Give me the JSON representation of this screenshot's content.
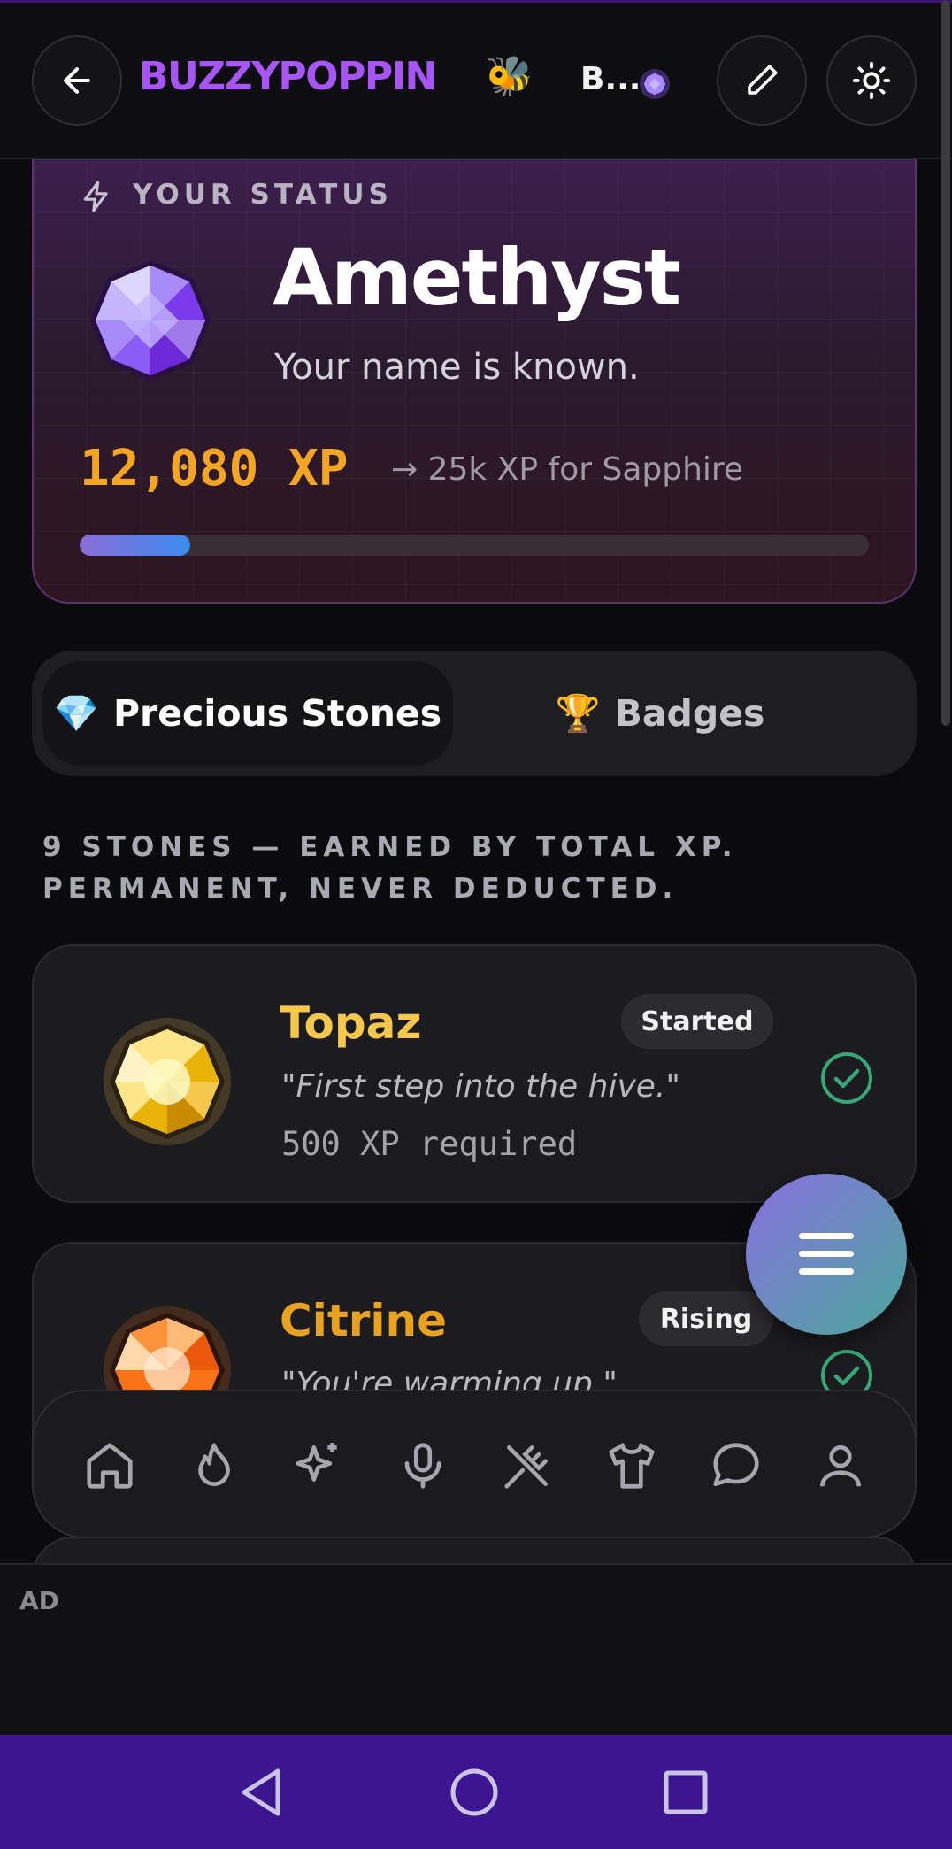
{
  "header": {
    "brand": "BUZZYPOPPIN",
    "brand_emoji": "🐝",
    "user_name": "B...",
    "icons": [
      "back-arrow-icon",
      "pencil-icon",
      "sun-icon"
    ]
  },
  "status": {
    "label": "YOUR STATUS",
    "rank": "Amethyst",
    "tagline": "Your name is known.",
    "xp": "12,080 XP",
    "next_goal": "→ 25k XP for Sapphire",
    "progress_fraction": 0.14
  },
  "tabs": [
    {
      "emoji": "💎",
      "label": "Precious Stones",
      "active": true
    },
    {
      "emoji": "🏆",
      "label": "Badges",
      "active": false
    }
  ],
  "section_note": "9 STONES — EARNED BY TOTAL XP. PERMANENT, NEVER DEDUCTED.",
  "stones": [
    {
      "name": "Topaz",
      "badge": "Started",
      "quote": "\"First step into the hive.\"",
      "requirement": "500 XP required",
      "color": "#f5c84c",
      "earned": true
    },
    {
      "name": "Citrine",
      "badge": "Rising",
      "quote": "\"You're warming up.\"",
      "requirement": "",
      "color": "#e8a21e",
      "earned": true
    }
  ],
  "bottom_nav": [
    "home-icon",
    "flame-icon",
    "sparkles-icon",
    "microphone-icon",
    "utensils-crossed-icon",
    "shirt-icon",
    "chat-bubble-icon",
    "user-icon"
  ],
  "ad": {
    "label": "AD"
  },
  "colors": {
    "accent": "#a855f7",
    "xp": "#f5a524",
    "check": "#34a87a",
    "system_nav": "#3b1690"
  }
}
